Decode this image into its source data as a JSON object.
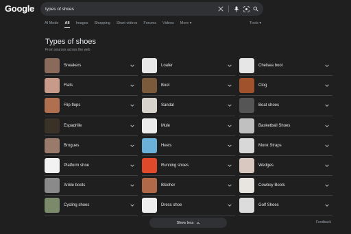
{
  "logo": "Google",
  "search": {
    "query": "types of shoes"
  },
  "tabs": [
    {
      "label": "AI Mode",
      "active": false
    },
    {
      "label": "All",
      "active": true
    },
    {
      "label": "Images",
      "active": false
    },
    {
      "label": "Shopping",
      "active": false
    },
    {
      "label": "Short videos",
      "active": false
    },
    {
      "label": "Forums",
      "active": false
    },
    {
      "label": "Videos",
      "active": false
    },
    {
      "label": "More ▾",
      "active": false
    }
  ],
  "tools_label": "Tools ▾",
  "section": {
    "title": "Types of shoes",
    "subtitle": "From sources across the web"
  },
  "items": [
    {
      "label": "Sneakers",
      "color": "#8a6a5a"
    },
    {
      "label": "Loafer",
      "color": "#e8e8e8"
    },
    {
      "label": "Chelsea boot",
      "color": "#e6e6e6"
    },
    {
      "label": "Flats",
      "color": "#c79a8a"
    },
    {
      "label": "Boot",
      "color": "#7a5a3a"
    },
    {
      "label": "Clog",
      "color": "#a0522d"
    },
    {
      "label": "Flip-flops",
      "color": "#b07050"
    },
    {
      "label": "Sandal",
      "color": "#d8d2cc"
    },
    {
      "label": "Boat shoes",
      "color": "#555555"
    },
    {
      "label": "Espadrille",
      "color": "#3a3226"
    },
    {
      "label": "Mule",
      "color": "#ececec"
    },
    {
      "label": "Basketball Shoes",
      "color": "#c0c0c0"
    },
    {
      "label": "Brogues",
      "color": "#9a7a6a"
    },
    {
      "label": "Heels",
      "color": "#6ab0d8"
    },
    {
      "label": "Monk Straps",
      "color": "#d8d8d8"
    },
    {
      "label": "Platform shoe",
      "color": "#f2f2f2"
    },
    {
      "label": "Running shoes",
      "color": "#e04a2a"
    },
    {
      "label": "Wedges",
      "color": "#d8c8c0"
    },
    {
      "label": "Ankle boots",
      "color": "#8a8a8a"
    },
    {
      "label": "Blücher",
      "color": "#b06a4a"
    },
    {
      "label": "Cowboy Boots",
      "color": "#e8e4e0"
    },
    {
      "label": "Cycling shoes",
      "color": "#7a8a6a"
    },
    {
      "label": "Dress shoe",
      "color": "#eeeeee"
    },
    {
      "label": "Golf Shoes",
      "color": "#dcdcdc"
    }
  ],
  "show_less_label": "Show less",
  "feedback_label": "Feedback"
}
